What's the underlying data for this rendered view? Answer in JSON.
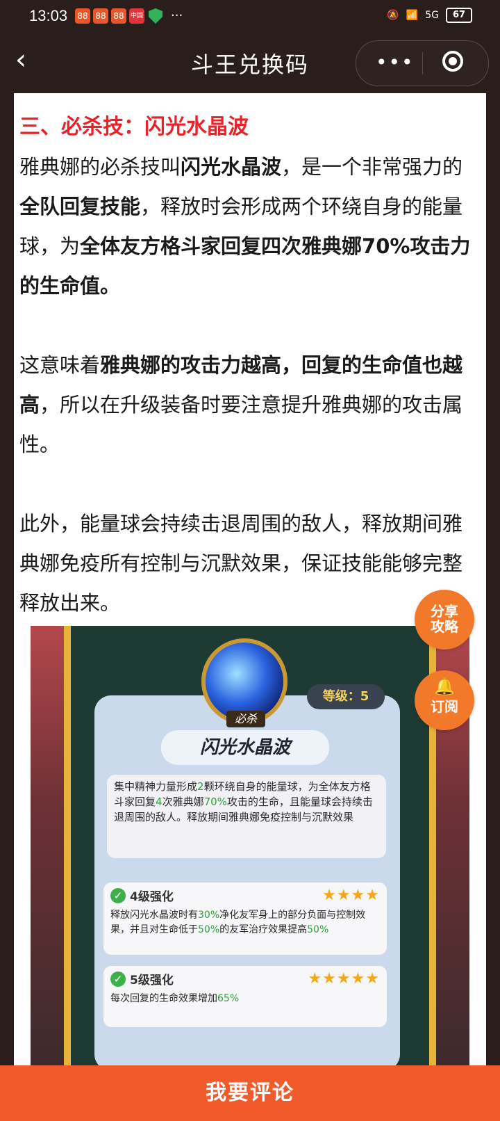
{
  "status_bar": {
    "time": "13:03",
    "app_icon": "88",
    "red_icon": "中国",
    "dots": "···",
    "network": "5G",
    "battery": "67"
  },
  "nav": {
    "back_glyph": "‹",
    "title": "斗王兑换码",
    "more_glyph": "•••"
  },
  "article": {
    "heading": "三、必杀技：闪光水晶波",
    "p1": [
      {
        "t": "雅典娜的必杀技叫",
        "b": false
      },
      {
        "t": "闪光水晶波",
        "b": true
      },
      {
        "t": "，是一个非常强力的",
        "b": false
      },
      {
        "t": "全队回复技能",
        "b": true
      },
      {
        "t": "，释放时会形成两个环绕自身的能量球，为",
        "b": false
      },
      {
        "t": "全体友方格斗家回复四次雅典娜70%攻击力的生命值。",
        "b": true
      }
    ],
    "p2": [
      {
        "t": "这意味着",
        "b": false
      },
      {
        "t": "雅典娜的攻击力越高，回复的生命值也越高",
        "b": true
      },
      {
        "t": "，所以在升级装备时要注意提升雅典娜的攻击属性。",
        "b": false
      }
    ],
    "p3": "此外，能量球会持续击退周围的敌人，释放期间雅典娜免疫所有控制与沉默效果，保证技能能够完整释放出来。"
  },
  "game_card": {
    "badge": "必杀",
    "level": "等级：5",
    "skill_name": "闪光水晶波",
    "desc": [
      {
        "t": "集中精神力量形成",
        "g": false
      },
      {
        "t": "2",
        "g": true
      },
      {
        "t": "颗环绕自身的能量球，为全体友方格斗家回复",
        "g": false
      },
      {
        "t": "4",
        "g": true
      },
      {
        "t": "次雅典娜",
        "g": false
      },
      {
        "t": "70%",
        "g": true
      },
      {
        "t": "攻击的生命，且能量球会持续击退周围的敌人。释放期间雅典娜免疫控制与沉默效果",
        "g": false
      }
    ],
    "upgrades": [
      {
        "title": "4级强化",
        "stars": "★★★★",
        "text": [
          {
            "t": "释放闪光水晶波时有",
            "g": false
          },
          {
            "t": "30%",
            "g": true
          },
          {
            "t": "净化友军身上的部分负面与控制效果，并且对生命低于",
            "g": false
          },
          {
            "t": "50%",
            "g": true
          },
          {
            "t": "的友军治疗效果提高",
            "g": false
          },
          {
            "t": "50%",
            "g": true
          }
        ]
      },
      {
        "title": "5级强化",
        "stars": "★★★★★",
        "text": [
          {
            "t": "每次回复的生命效果增加",
            "g": false
          },
          {
            "t": "65%",
            "g": true
          }
        ]
      }
    ]
  },
  "fab": {
    "share": "分享攻略",
    "subscribe": "订阅",
    "bell_glyph": "🔔"
  },
  "bottom": {
    "comment_label": "我要评论"
  },
  "colors": {
    "accent": "#f15a2a",
    "heading_red": "#e8212a",
    "nav_bg": "#2a1e1c"
  }
}
